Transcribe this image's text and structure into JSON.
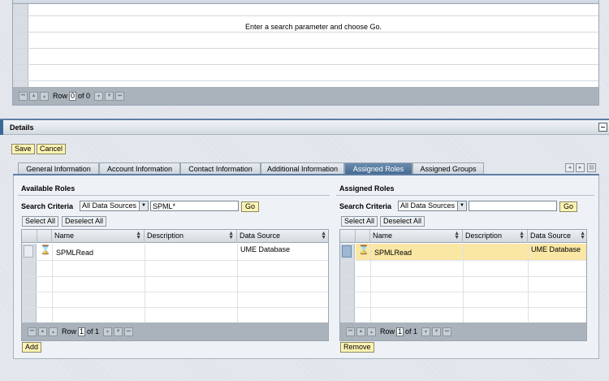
{
  "top_table": {
    "message": "Enter a search parameter and choose Go.",
    "pager": {
      "row_label": "Row",
      "row_value": "0",
      "of_label": "of 0"
    }
  },
  "details": {
    "title": "Details",
    "save_label": "Save",
    "cancel_label": "Cancel"
  },
  "tabs": [
    {
      "label": "General Information",
      "active": false
    },
    {
      "label": "Account Information",
      "active": false
    },
    {
      "label": "Contact Information",
      "active": false
    },
    {
      "label": "Additional Information",
      "active": false
    },
    {
      "label": "Assigned Roles",
      "active": true
    },
    {
      "label": "Assigned Groups",
      "active": false
    }
  ],
  "available_roles": {
    "title": "Available Roles",
    "search_label": "Search Criteria",
    "data_source": "All Data Sources",
    "search_value": "SPML*",
    "go_label": "Go",
    "select_all_label": "Select All",
    "deselect_all_label": "Deselect All",
    "columns": [
      "Name",
      "Description",
      "Data Source"
    ],
    "rows": [
      {
        "name": "SPMLRead",
        "description": "",
        "source": "UME Database"
      }
    ],
    "pager": {
      "row_label": "Row",
      "row_value": "1",
      "of_label": "of 1"
    },
    "action_label": "Add"
  },
  "assigned_roles": {
    "title": "Assigned Roles",
    "search_label": "Search Criteria",
    "data_source": "All Data Sources",
    "search_value": "",
    "go_label": "Go",
    "select_all_label": "Select All",
    "deselect_all_label": "Deselect All",
    "columns": [
      "Name",
      "Description",
      "Data Source"
    ],
    "rows": [
      {
        "name": "SPMLRead",
        "description": "",
        "source": "UME Database"
      }
    ],
    "pager": {
      "row_label": "Row",
      "row_value": "1",
      "of_label": "of 1"
    },
    "action_label": "Remove"
  },
  "colors": {
    "accent": "#45698f",
    "button_yellow": "#fff3b4",
    "selected_row": "#fae7a4"
  }
}
